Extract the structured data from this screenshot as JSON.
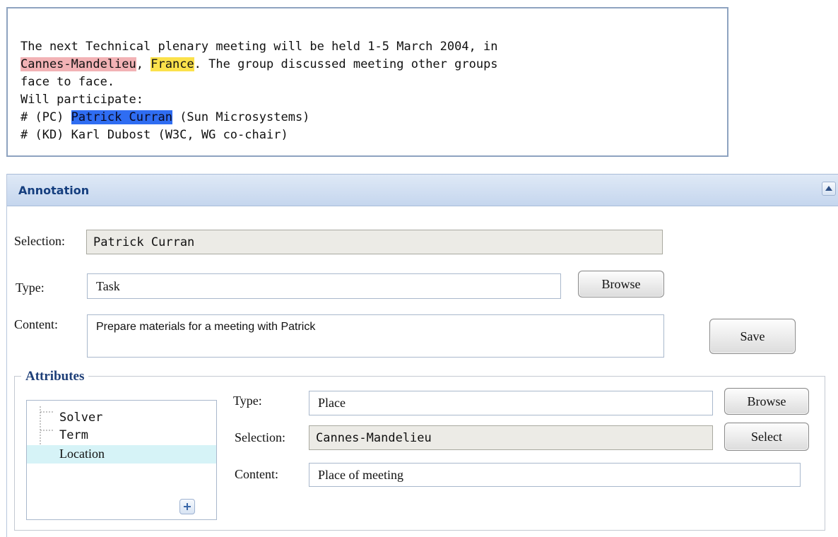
{
  "document": {
    "line1": "The next Technical plenary meeting will be held 1-5 March 2004, in",
    "highlight_place": "Cannes-Mandelieu",
    "sep1": ", ",
    "highlight_country": "France",
    "line2_rest": ". The group discussed meeting other groups",
    "line3": "face to face.",
    "line4": "Will participate:",
    "line5_prefix": "# (PC) ",
    "highlight_person": "Patrick Curran",
    "line5_rest": " (Sun Microsystems)",
    "line6": "# (KD) Karl Dubost (W3C, WG co-chair)",
    "colors": {
      "place": "#f2b2b5",
      "country": "#fbe14b",
      "person": "#2f6df2"
    }
  },
  "annotation": {
    "title": "Annotation",
    "collapse_icon": "chevron-up-icon",
    "selection_label": "Selection:",
    "selection_value": "Patrick Curran",
    "type_label": "Type:",
    "type_value": "Task",
    "browse_label": "Browse",
    "content_label": "Content:",
    "content_value": "Prepare materials for a meeting with Patrick",
    "save_label": "Save"
  },
  "attributes": {
    "legend": "Attributes",
    "tree": [
      {
        "label": "Solver",
        "selected": false
      },
      {
        "label": "Term",
        "selected": false
      },
      {
        "label": "Location",
        "selected": true
      }
    ],
    "add_icon": "plus-icon",
    "type_label": "Type:",
    "type_value": "Place",
    "browse_label": "Browse",
    "selection_label": "Selection:",
    "selection_value": "Cannes-Mandelieu",
    "select_label": "Select",
    "content_label": "Content:",
    "content_value": "Place of meeting"
  }
}
